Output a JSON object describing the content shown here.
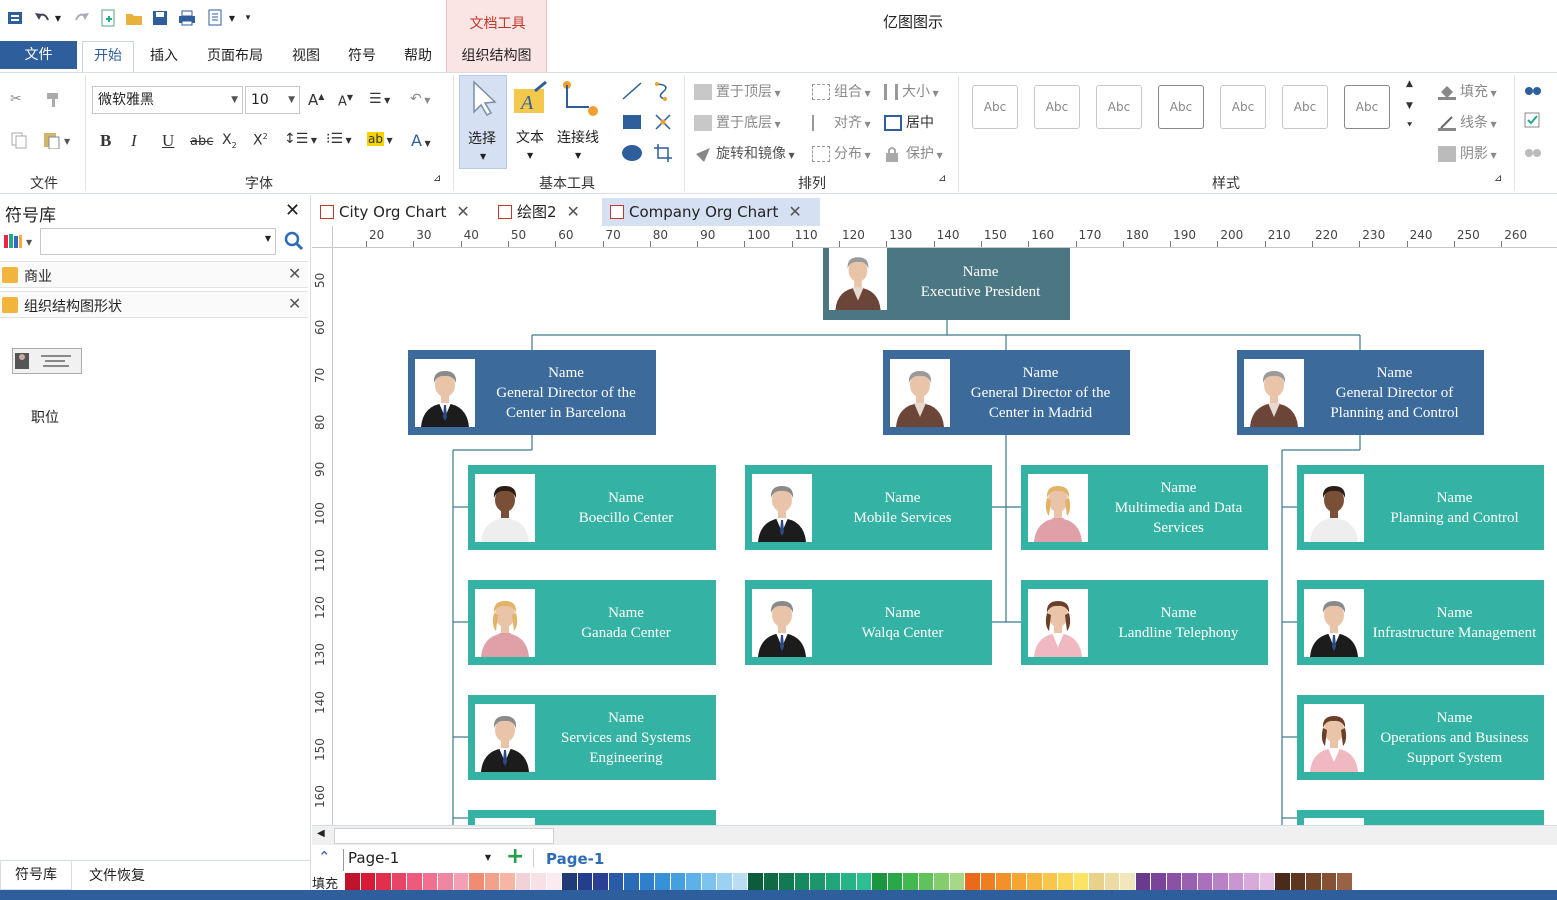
{
  "app": {
    "title": "亿图图示",
    "context_tab_group": "文档工具"
  },
  "menu": {
    "file": "文件",
    "home": "开始",
    "insert": "插入",
    "page_layout": "页面布局",
    "view": "视图",
    "symbols": "符号",
    "help": "帮助",
    "org_chart": "组织结构图"
  },
  "ribbon": {
    "groups": {
      "file": "文件",
      "font": "字体",
      "basic_tools": "基本工具",
      "arrange": "排列",
      "style": "样式"
    },
    "font_name": "微软雅黑",
    "font_size": "10",
    "tools": {
      "select": "选择",
      "text": "文本",
      "connector": "连接线"
    },
    "arrange": {
      "bring_front": "置于顶层",
      "send_back": "置于底层",
      "rotate_mirror": "旋转和镜像",
      "group": "组合",
      "align": "对齐",
      "distribute": "分布",
      "size": "大小",
      "center": "居中",
      "protect": "保护"
    },
    "styles": [
      "Abc",
      "Abc",
      "Abc",
      "Abc",
      "Abc",
      "Abc",
      "Abc"
    ],
    "fill": "填充",
    "line": "线条",
    "shadow": "阴影"
  },
  "left_panel": {
    "title": "符号库",
    "libraries": [
      "商业",
      "组织结构图形状"
    ],
    "shape_label": "职位",
    "tabs": [
      "符号库",
      "文件恢复"
    ]
  },
  "doc_tabs": [
    {
      "label": "City Org Chart"
    },
    {
      "label": "绘图2"
    },
    {
      "label": "Company Org Chart",
      "active": true
    }
  ],
  "ruler": {
    "h_ticks": [
      "20",
      "30",
      "40",
      "50",
      "60",
      "70",
      "80",
      "90",
      "100",
      "110",
      "120",
      "130",
      "140",
      "150",
      "160",
      "170",
      "180",
      "190",
      "200",
      "210",
      "220",
      "230",
      "240",
      "250",
      "260"
    ],
    "v_ticks": [
      "50",
      "60",
      "70",
      "80",
      "90",
      "100",
      "110",
      "120",
      "130",
      "140",
      "150",
      "160"
    ]
  },
  "org": {
    "colors": {
      "executive": "#4b7783",
      "director": "#3c6a9b",
      "staff": "#34b3a4",
      "line": "#3a7a8a"
    },
    "nodes": [
      {
        "id": "ep",
        "level": "executive",
        "name": "Name",
        "title": "Executive President",
        "photo": "man-gray"
      },
      {
        "id": "d1",
        "level": "director",
        "name": "Name",
        "title": "General Director of the Center in Barcelona",
        "photo": "man-suit"
      },
      {
        "id": "d2",
        "level": "director",
        "name": "Name",
        "title": "General Director of the Center in Madrid",
        "photo": "man-gray"
      },
      {
        "id": "d3",
        "level": "director",
        "name": "Name",
        "title": "General Director of Planning and Control",
        "photo": "man-gray"
      },
      {
        "id": "s1",
        "level": "staff",
        "name": "Name",
        "title": "Boecillo Center",
        "photo": "man-shirt"
      },
      {
        "id": "s2",
        "level": "staff",
        "name": "Name",
        "title": "Ganada Center",
        "photo": "woman-blonde"
      },
      {
        "id": "s3",
        "level": "staff",
        "name": "Name",
        "title": "Services and Systems Engineering",
        "photo": "man-suit"
      },
      {
        "id": "s4",
        "level": "staff",
        "name": "Name",
        "title": "Mobile Services",
        "photo": "man-suit"
      },
      {
        "id": "s5",
        "level": "staff",
        "name": "Name",
        "title": "Walqa Center",
        "photo": "man-suit"
      },
      {
        "id": "s6",
        "level": "staff",
        "name": "Name",
        "title": "Multimedia and Data Services",
        "photo": "woman-blonde"
      },
      {
        "id": "s7",
        "level": "staff",
        "name": "Name",
        "title": "Landline Telephony",
        "photo": "woman-dark"
      },
      {
        "id": "s8",
        "level": "staff",
        "name": "Name",
        "title": "Planning and Control",
        "photo": "man-shirt"
      },
      {
        "id": "s9",
        "level": "staff",
        "name": "Name",
        "title": "Infrastructure Management",
        "photo": "man-suit"
      },
      {
        "id": "s10",
        "level": "staff",
        "name": "Name",
        "title": "Operations and Business Support System",
        "photo": "woman-dark"
      }
    ]
  },
  "page_bar": {
    "current_page": "Page-1",
    "page_tab": "Page-1"
  },
  "palette": {
    "label": "填充",
    "colors": [
      "#c0142c",
      "#d81a36",
      "#e0304c",
      "#e64565",
      "#ec5b7b",
      "#f07090",
      "#f087a2",
      "#f4a0b4",
      "#f08c74",
      "#f4a18c",
      "#f7b6a4",
      "#f1d2d8",
      "#f7e0e6",
      "#fbeaf0",
      "#1f3c74",
      "#243e8c",
      "#2c3f95",
      "#2b5aa8",
      "#2a6cb8",
      "#2f80c8",
      "#3890d6",
      "#45a0e0",
      "#5cb2e8",
      "#7cc4ee",
      "#9bd2f2",
      "#b9def4",
      "#0b5c3a",
      "#0e6b46",
      "#127a52",
      "#17895e",
      "#1b976b",
      "#20a678",
      "#26b385",
      "#2dbf92",
      "#1a9640",
      "#28a848",
      "#42b84f",
      "#60c25b",
      "#84cc6c",
      "#a7d888",
      "#e86a1a",
      "#ee7e22",
      "#f2912a",
      "#f4a534",
      "#f6b63e",
      "#f8c64a",
      "#f9d657",
      "#f9e466",
      "#e8d28a",
      "#ecdba2",
      "#f2e6bc",
      "#6a3a8c",
      "#7a4598",
      "#8a52a6",
      "#9a60b2",
      "#aa70bc",
      "#ba82c6",
      "#ca96d2",
      "#d8aadc",
      "#e6c0e6",
      "#4a2a18",
      "#5e3620",
      "#72442a",
      "#865236",
      "#9a6244"
    ]
  }
}
